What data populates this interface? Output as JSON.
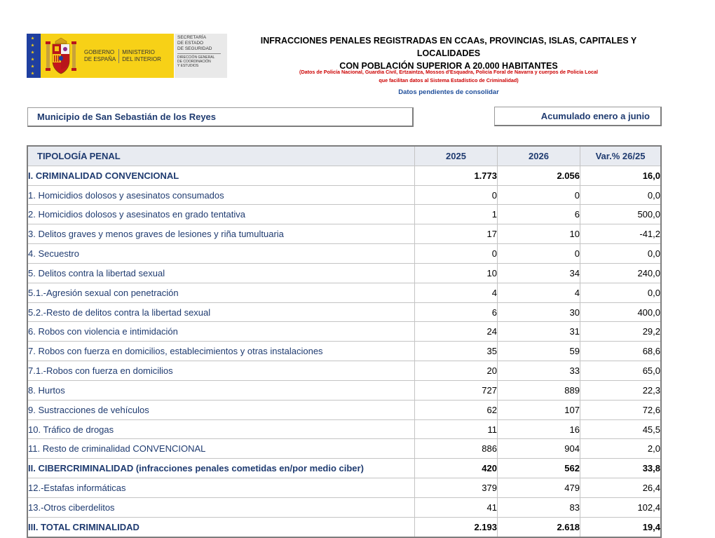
{
  "logo": {
    "gov_line1": "GOBIERNO",
    "gov_line2": "DE ESPAÑA",
    "min_line1": "MINISTERIO",
    "min_line2": "DEL INTERIOR",
    "sec_line1": "SECRETARÍA",
    "sec_line2": "DE ESTADO",
    "sec_line3": "DE SEGURIDAD",
    "dir_line1": "DIRECCIÓN GENERAL",
    "dir_line2": "DE COORDINACIÓN",
    "dir_line3": "Y ESTUDIOS"
  },
  "header": {
    "title_line1": "INFRACCIONES PENALES REGISTRADAS EN CCAAs, PROVINCIAS, ISLAS, CAPITALES Y LOCALIDADES",
    "title_line2": "CON POBLACIÓN SUPERIOR A 20.000 HABITANTES",
    "source_line1": "(Datos de Policía Nacional, Guardia Civil, Ertzaintza, Mossos d'Esquadra, Policía Foral de Navarra y cuerpos de Policía Local",
    "source_line2": "que facilitan datos al Sistema Estadístico de Criminalidad)",
    "pending": "Datos pendientes de consolidar"
  },
  "municipality": "Municipio de San Sebastián de los Reyes",
  "period": "Acumulado enero a junio",
  "colors": {
    "title_blue": "#1f3b70",
    "source_red": "#cc0000",
    "pending_blue": "#1f4e9a",
    "header_bg": "#e8ebf1",
    "logo_yellow": "#f7d117"
  },
  "table": {
    "headers": [
      "TIPOLOGÍA PENAL",
      "2025",
      "2026",
      "Var.% 26/25"
    ],
    "rows": [
      {
        "label": "I. CRIMINALIDAD CONVENCIONAL",
        "y2025": "1.773",
        "y2026": "2.056",
        "var": "16,0",
        "bold": true
      },
      {
        "label": "1. Homicidios dolosos y asesinatos consumados",
        "y2025": "0",
        "y2026": "0",
        "var": "0,0"
      },
      {
        "label": "2. Homicidios dolosos y asesinatos en grado tentativa",
        "y2025": "1",
        "y2026": "6",
        "var": "500,0"
      },
      {
        "label": "3. Delitos graves y menos graves de lesiones y riña tumultuaria",
        "y2025": "17",
        "y2026": "10",
        "var": "-41,2"
      },
      {
        "label": "4. Secuestro",
        "y2025": "0",
        "y2026": "0",
        "var": "0,0"
      },
      {
        "label": "5. Delitos contra la libertad sexual",
        "y2025": "10",
        "y2026": "34",
        "var": "240,0"
      },
      {
        "label": "5.1.-Agresión sexual con penetración",
        "y2025": "4",
        "y2026": "4",
        "var": "0,0"
      },
      {
        "label": "5.2.-Resto de delitos contra la libertad sexual",
        "y2025": "6",
        "y2026": "30",
        "var": "400,0"
      },
      {
        "label": "6. Robos con violencia e intimidación",
        "y2025": "24",
        "y2026": "31",
        "var": "29,2"
      },
      {
        "label": "7. Robos con fuerza en domicilios, establecimientos y otras instalaciones",
        "y2025": "35",
        "y2026": "59",
        "var": "68,6"
      },
      {
        "label": "7.1.-Robos con fuerza en domicilios",
        "y2025": "20",
        "y2026": "33",
        "var": "65,0"
      },
      {
        "label": "8. Hurtos",
        "y2025": "727",
        "y2026": "889",
        "var": "22,3"
      },
      {
        "label": "9. Sustracciones de vehículos",
        "y2025": "62",
        "y2026": "107",
        "var": "72,6"
      },
      {
        "label": "10. Tráfico de drogas",
        "y2025": "11",
        "y2026": "16",
        "var": "45,5"
      },
      {
        "label": "11. Resto de criminalidad CONVENCIONAL",
        "y2025": "886",
        "y2026": "904",
        "var": "2,0"
      },
      {
        "label": "II. CIBERCRIMINALIDAD (infracciones penales cometidas en/por medio ciber)",
        "y2025": "420",
        "y2026": "562",
        "var": "33,8",
        "bold": true
      },
      {
        "label": "12.-Estafas informáticas",
        "y2025": "379",
        "y2026": "479",
        "var": "26,4"
      },
      {
        "label": "13.-Otros ciberdelitos",
        "y2025": "41",
        "y2026": "83",
        "var": "102,4"
      },
      {
        "label": "III. TOTAL CRIMINALIDAD",
        "y2025": "2.193",
        "y2026": "2.618",
        "var": "19,4",
        "bold": true
      }
    ]
  }
}
